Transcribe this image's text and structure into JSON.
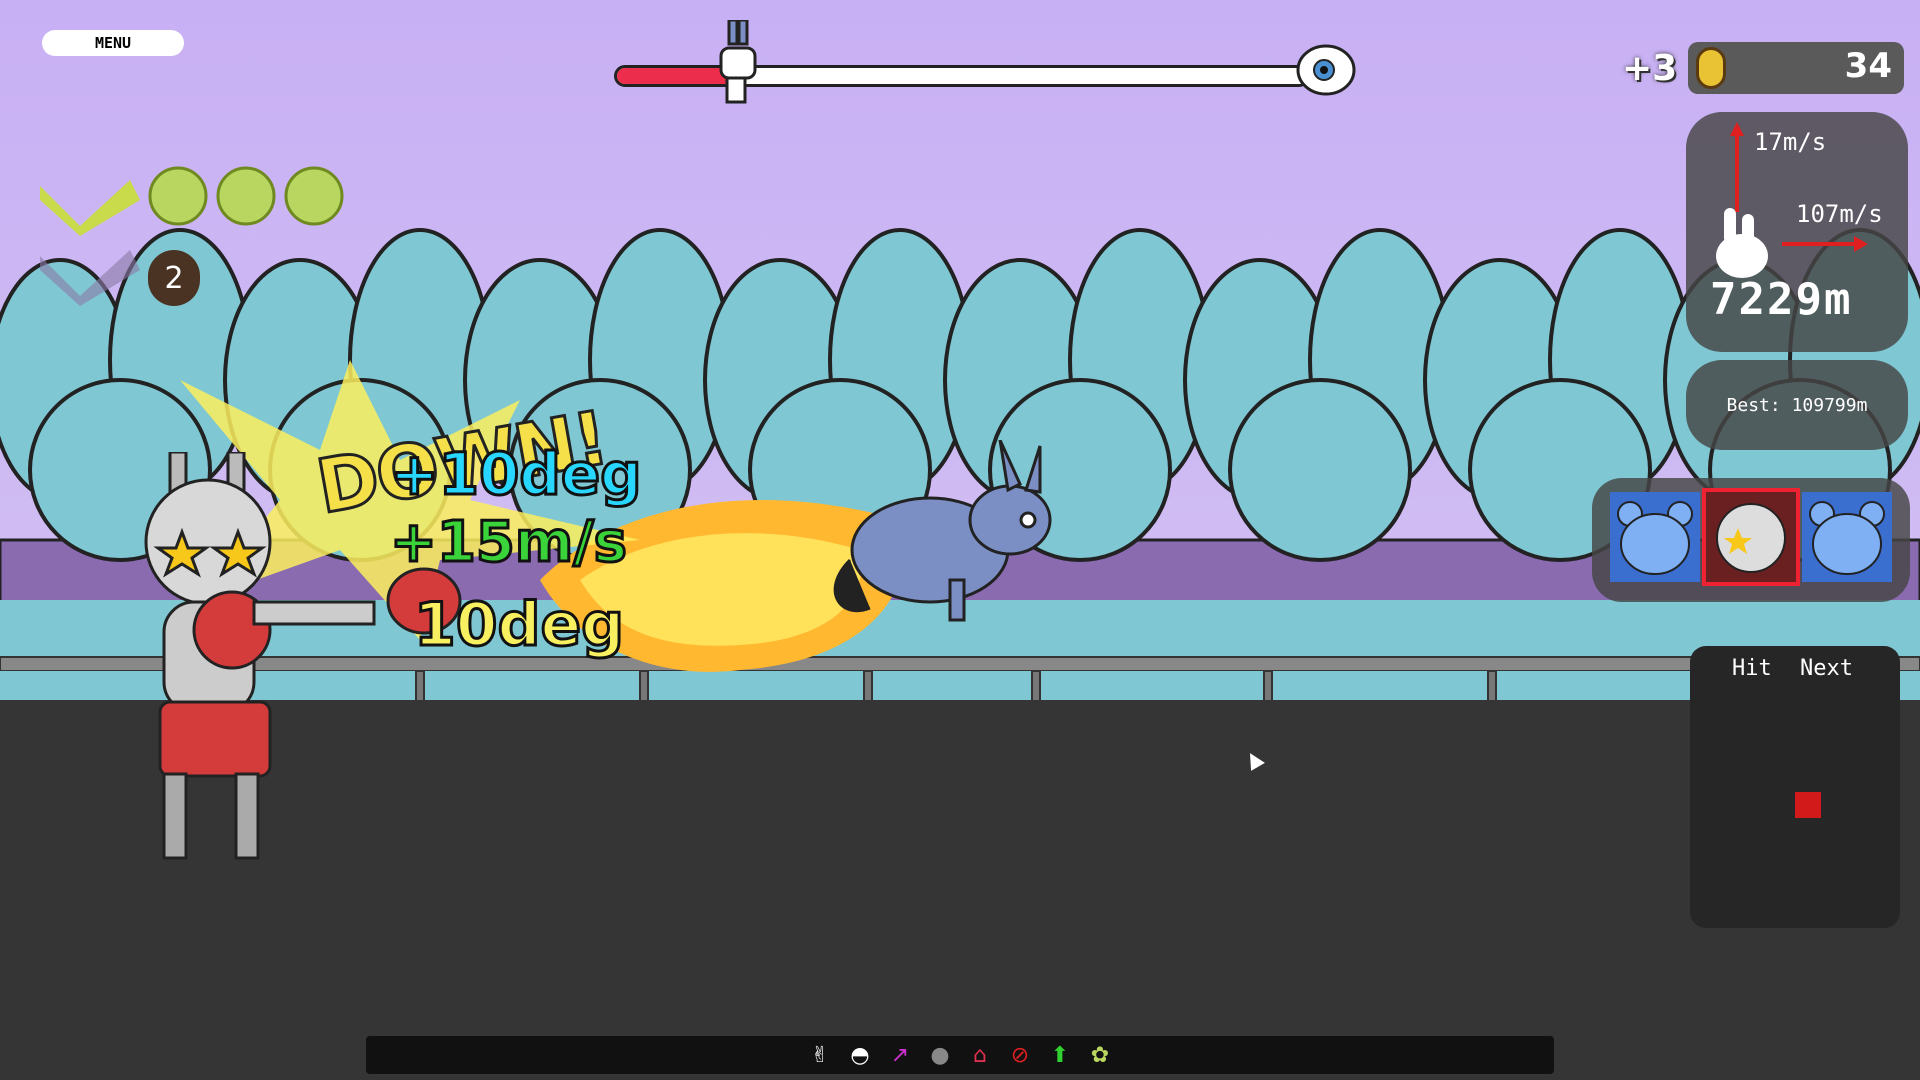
{
  "menu": {
    "label": "MENU"
  },
  "progress": {
    "fraction": 0.18
  },
  "combo": {
    "count": "2"
  },
  "coins": {
    "bonus": "+3",
    "count": "34"
  },
  "stats": {
    "vertical_speed": "17m/s",
    "horizontal_speed": "107m/s",
    "distance": "7229m",
    "best": "Best: 109799m"
  },
  "characters": {
    "selected_index": 1,
    "names": [
      "bear-avatar",
      "robot-avatar",
      "bear-avatar"
    ]
  },
  "hit_next": {
    "hit_label": "Hit",
    "next_label": "Next"
  },
  "popups": {
    "line1": "DOWN!",
    "line2": "+10deg",
    "line3": "+15m/s",
    "line4": "10deg"
  },
  "toolbar": {
    "icons": [
      "bunny-icon",
      "cat-icon",
      "arrow-diagonal-icon",
      "cat-face-icon",
      "house-up-icon",
      "no-icon",
      "arrow-up-icon",
      "cloud-icon"
    ]
  },
  "colors": {
    "sky": "#c8b0f4",
    "trees": "#7fc7d2",
    "road": "#353535",
    "progress_fill": "#ec2e4c",
    "panel": "#464646"
  }
}
